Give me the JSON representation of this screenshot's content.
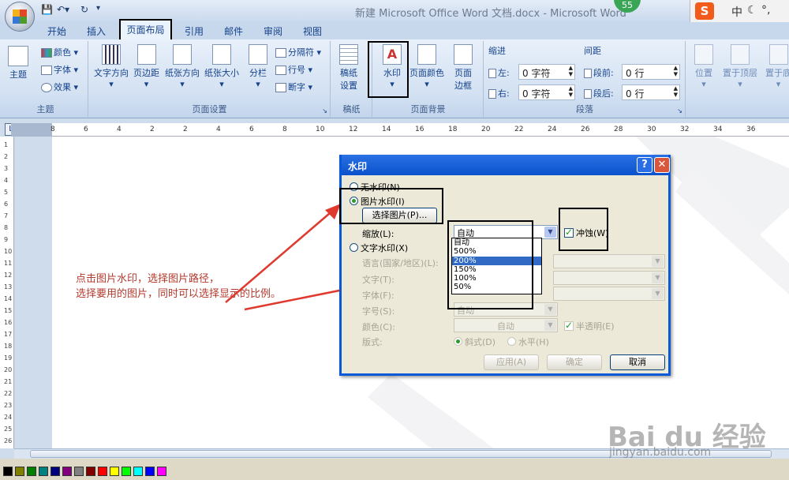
{
  "window": {
    "title": "新建 Microsoft Office Word 文档.docx - Microsoft Word",
    "badge": "55",
    "ime": {
      "logo": "S",
      "mode": "中"
    },
    "quick_access": {
      "save_icon": "save-icon",
      "undo_icon": "undo-icon",
      "redo_icon": "redo-icon"
    }
  },
  "tabs": [
    "开始",
    "插入",
    "页面布局",
    "引用",
    "邮件",
    "审阅",
    "视图"
  ],
  "ribbon": {
    "theme_group": {
      "label": "主题",
      "main": "主题",
      "colors": "颜色",
      "fonts": "字体",
      "effects": "效果"
    },
    "page_setup": {
      "label": "页面设置",
      "text_dir": "文字方向",
      "margins": "页边距",
      "orientation": "纸张方向",
      "size": "纸张大小",
      "columns": "分栏",
      "breaks": "分隔符",
      "line_numbers": "行号",
      "hyphen": "断字"
    },
    "draft": {
      "label": "稿纸",
      "settings": "稿纸\n设置"
    },
    "page_bg": {
      "label": "页面背景",
      "watermark": "水印",
      "page_color": "页面颜色",
      "page_border": "页面\n边框"
    },
    "paragraph": {
      "label": "段落",
      "indent": "缩进",
      "spacing": "间距",
      "left": "左:",
      "right": "右:",
      "left_val": "0 字符",
      "right_val": "0 字符",
      "before": "段前:",
      "after": "段后:",
      "before_val": "0 行",
      "after_val": "0 行"
    },
    "arrange": {
      "position": "位置",
      "to_front": "置于顶层",
      "to_back": "置于底"
    }
  },
  "ruler": {
    "marks": [
      "8",
      "6",
      "4",
      "2",
      "2",
      "4",
      "6",
      "8",
      "10",
      "12",
      "14",
      "16",
      "18",
      "20",
      "22",
      "24",
      "26",
      "28",
      "30",
      "32",
      "34",
      "36"
    ]
  },
  "vruler": {
    "marks": [
      "1",
      "2",
      "3",
      "4",
      "5",
      "6",
      "7",
      "8",
      "9",
      "10",
      "11",
      "12",
      "13",
      "14",
      "15",
      "16",
      "17",
      "18",
      "19",
      "20",
      "21",
      "22",
      "23",
      "24",
      "25",
      "26"
    ]
  },
  "dialog": {
    "title": "水印",
    "help": "?",
    "close": "✕",
    "no_watermark": "无水印(N)",
    "picture_watermark": "图片水印(I)",
    "select_picture": "选择图片(P)...",
    "scale_label": "缩放(L):",
    "scale_value": "自动",
    "washout": "冲蚀(W)",
    "scale_options": [
      "自动",
      "500%",
      "200%",
      "150%",
      "100%",
      "50%"
    ],
    "scale_selected": "200%",
    "text_watermark": "文字水印(X)",
    "language_label": "语言(国家/地区)(L):",
    "text_label": "文字(T):",
    "font_label": "字体(F):",
    "size_label": "字号(S):",
    "size_value": "自动",
    "color_label": "颜色(C):",
    "color_value": "自动",
    "semi_transparent": "半透明(E)",
    "layout_label": "版式:",
    "diagonal": "斜式(D)",
    "horizontal": "水平(H)",
    "apply": "应用(A)",
    "ok": "确定",
    "cancel": "取消"
  },
  "annotation": "点击图片水印，选择图片路径，\n选择要用的图片，同时可以选择显示的比例。",
  "watermark": {
    "brand": "Bai du 经验",
    "url": "jingyan.baidu.com"
  },
  "palette": [
    "#000000",
    "#808000",
    "#008000",
    "#008080",
    "#000080",
    "#800080",
    "#808080",
    "#800000",
    "#ff0000",
    "#ffff00",
    "#00ff00",
    "#00ffff",
    "#0000ff",
    "#ff00ff"
  ],
  "colors": {
    "accent": "#0a52cc",
    "annotation": "#b43a2e",
    "selection": "#316ac5"
  }
}
